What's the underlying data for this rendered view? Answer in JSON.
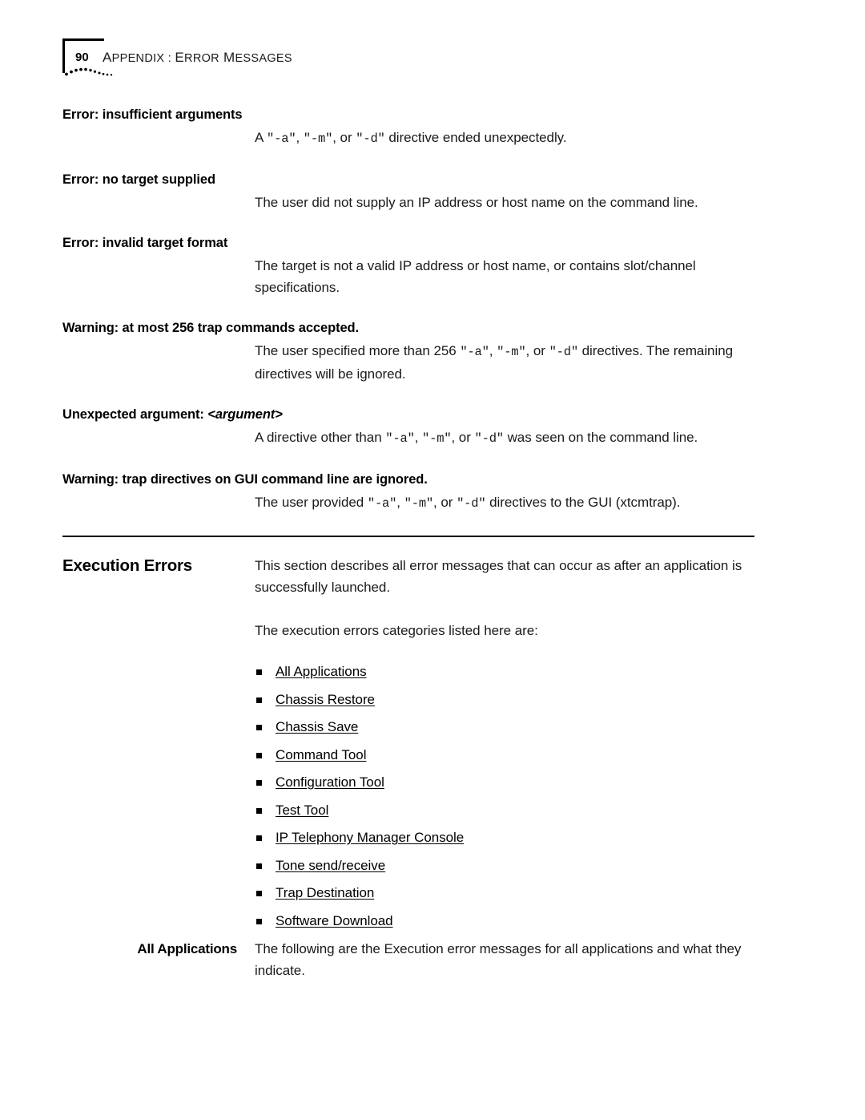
{
  "header": {
    "page_number": "90",
    "title_prefix_cap": "A",
    "title_rest": "PPENDIX",
    "title_sep": " : ",
    "title_cap2": "E",
    "title_rest2": "RROR",
    "title_cap3": " M",
    "title_rest3": "ESSAGES",
    "title_full": "APPENDIX : ERROR MESSAGES",
    "decoration": "corner-bracket-with-dotted-arc"
  },
  "entries": [
    {
      "term": "Error: insufficient arguments",
      "definition_parts": [
        {
          "type": "text",
          "value": "A "
        },
        {
          "type": "code",
          "value": "\"-a\""
        },
        {
          "type": "text",
          "value": ", "
        },
        {
          "type": "code",
          "value": "\"-m\""
        },
        {
          "type": "text",
          "value": ", or "
        },
        {
          "type": "code",
          "value": "\"-d\""
        },
        {
          "type": "text",
          "value": " directive ended unexpectedly."
        }
      ],
      "definition_plain": "A \"-a\", \"-m\", or \"-d\" directive ended unexpectedly."
    },
    {
      "term": "Error: no target supplied",
      "definition_parts": [
        {
          "type": "text",
          "value": "The user did not supply an IP address or host name on the command line."
        }
      ],
      "definition_plain": "The user did not supply an IP address or host name on the command line."
    },
    {
      "term": "Error: invalid target format",
      "definition_parts": [
        {
          "type": "text",
          "value": "The target is not a valid IP address or host name, or contains slot/channel specifications."
        }
      ],
      "definition_plain": "The target is not a valid IP address or host name, or contains slot/channel specifications."
    },
    {
      "term": "Warning: at most 256 trap commands accepted.",
      "definition_parts": [
        {
          "type": "text",
          "value": "The user specified more than 256 "
        },
        {
          "type": "code",
          "value": "\"-a\""
        },
        {
          "type": "text",
          "value": ", "
        },
        {
          "type": "code",
          "value": "\"-m\""
        },
        {
          "type": "text",
          "value": ", or "
        },
        {
          "type": "code",
          "value": "\"-d\""
        },
        {
          "type": "text",
          "value": " directives. The remaining directives will be ignored."
        }
      ],
      "definition_plain": "The user specified more than 256 \"-a\", \"-m\", or \"-d\" directives. The remaining directives will be ignored."
    },
    {
      "term_prefix": "Unexpected argument: ",
      "term_arg": "<argument>",
      "term": "Unexpected argument: <argument>",
      "definition_parts": [
        {
          "type": "text",
          "value": "A directive other than "
        },
        {
          "type": "code",
          "value": "\"-a\""
        },
        {
          "type": "text",
          "value": ", "
        },
        {
          "type": "code",
          "value": "\"-m\""
        },
        {
          "type": "text",
          "value": ", or "
        },
        {
          "type": "code",
          "value": "\"-d\""
        },
        {
          "type": "text",
          "value": " was seen on the command line."
        }
      ],
      "definition_plain": "A directive other than \"-a\", \"-m\", or \"-d\" was seen on the command line."
    },
    {
      "term": "Warning: trap directives on GUI command line are ignored.",
      "definition_parts": [
        {
          "type": "text",
          "value": "The user provided "
        },
        {
          "type": "code",
          "value": "\"-a\""
        },
        {
          "type": "text",
          "value": ", "
        },
        {
          "type": "code",
          "value": "\"-m\""
        },
        {
          "type": "text",
          "value": ", or "
        },
        {
          "type": "code",
          "value": "\"-d\""
        },
        {
          "type": "text",
          "value": " directives to the GUI (xtcmtrap)."
        }
      ],
      "definition_plain": "The user provided \"-a\", \"-m\", or \"-d\" directives to the GUI (xtcmtrap)."
    }
  ],
  "execution_errors": {
    "heading": "Execution Errors",
    "paragraph_1": "This section describes all error messages that can occur as after an application is successfully launched.",
    "paragraph_2": "The execution errors categories listed here are:",
    "links": [
      "All Applications",
      "Chassis Restore",
      "Chassis Save",
      "Command Tool",
      "Configuration Tool",
      "Test Tool",
      "IP Telephony Manager Console",
      "Tone send/receive",
      "Trap Destination",
      "Software Download"
    ]
  },
  "all_applications": {
    "heading": "All Applications",
    "paragraph": "The following are the Execution error messages for all applications and what they indicate."
  }
}
